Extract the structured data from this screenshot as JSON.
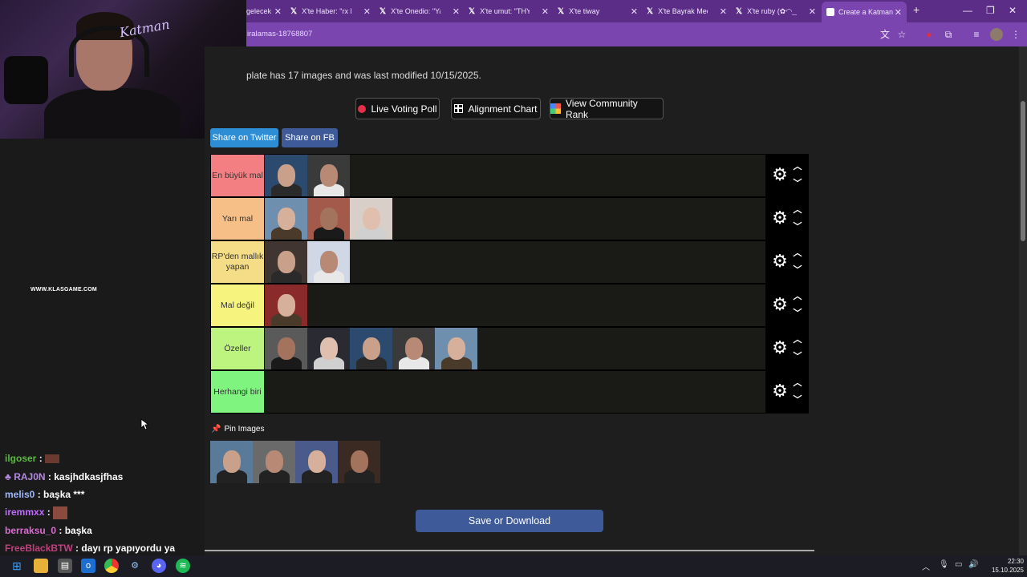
{
  "browser": {
    "tabs": [
      {
        "label": "gelecek",
        "active": false
      },
      {
        "label": "X'te Haber: \"rx Mi",
        "active": false
      },
      {
        "label": "X'te Onedio: \"Yatı",
        "active": false
      },
      {
        "label": "X'te umut: \"THY h",
        "active": false
      },
      {
        "label": "X'te tiway",
        "active": false
      },
      {
        "label": "X'te Bayrak Medy",
        "active": false
      },
      {
        "label": "X'te ruby (✿◠‿",
        "active": false
      },
      {
        "label": "Create a Katman",
        "active": true
      }
    ],
    "url": "iralamas-18768807"
  },
  "webcam": {
    "overlay_text": "Katman"
  },
  "stream": {
    "sponsor": "WWW.KLASGAME.COM",
    "chat": [
      {
        "user": "ilgoser",
        "message": "",
        "color": "#5ab840"
      },
      {
        "user": "RAJ0N",
        "message": "kasjhdkasjfhas",
        "color": "#b489e0"
      },
      {
        "user": "melis0",
        "message": "başka ***",
        "color": "#9fb7ff"
      },
      {
        "user": "iremmxx",
        "message": "",
        "color": "#c06cff"
      },
      {
        "user": "berraksu_0",
        "message": "başka",
        "color": "#d76dd0"
      },
      {
        "user": "FreeBlackBTW",
        "message": "dayı rp yapıyordu ya",
        "color": "#c0407e"
      }
    ]
  },
  "page": {
    "description": "plate has 17 images and was last modified 10/15/2025.",
    "buttons": {
      "live_voting": "Live Voting Poll",
      "alignment_chart": "Alignment Chart",
      "community_rank": "View Community Rank",
      "share_twitter": "Share on Twitter",
      "share_fb": "Share on FB",
      "save": "Save or Download"
    },
    "pin_label": "Pin Images"
  },
  "tiers": [
    {
      "label": "En büyük mal",
      "color": "#f47f82",
      "items": 2
    },
    {
      "label": "Yarı mal",
      "color": "#f5bf87",
      "items": 3
    },
    {
      "label": "RP'den mallık yapan",
      "color": "#f5dc87",
      "items": 2
    },
    {
      "label": "Mal değil",
      "color": "#f6f47f",
      "items": 1
    },
    {
      "label": "Özeller",
      "color": "#bdf47f",
      "items": 5
    },
    {
      "label": "Herhangi biri",
      "color": "#7ff47f",
      "items": 0
    }
  ],
  "pinned_images": 4,
  "system": {
    "time": "22:30",
    "date": "15.10.2025"
  }
}
